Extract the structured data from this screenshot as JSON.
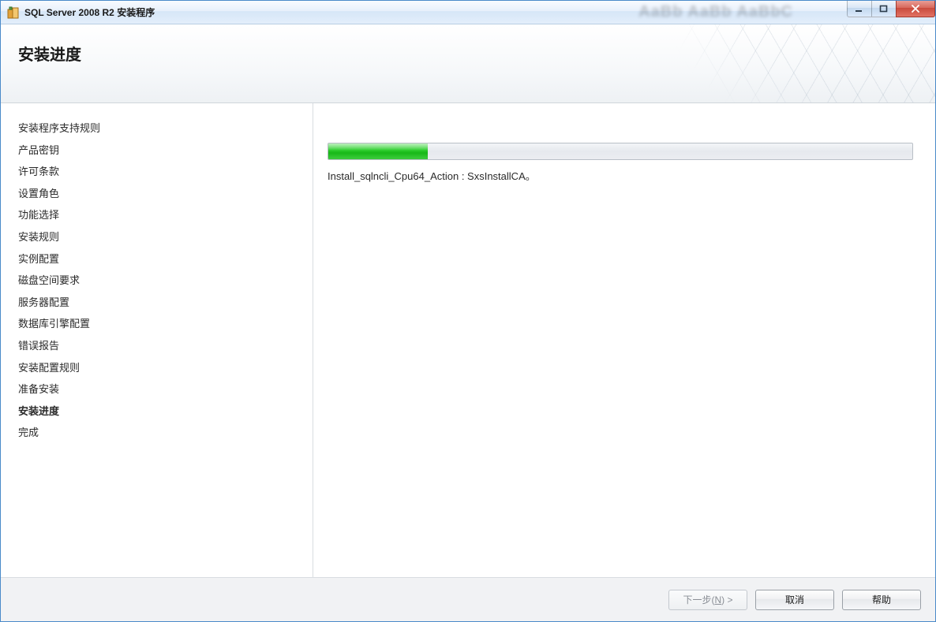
{
  "window": {
    "title": "SQL Server 2008 R2 安装程序"
  },
  "titlebar_bg_blur": "AaBb AaBb AaBbC",
  "header": {
    "page_title": "安装进度"
  },
  "sidebar": {
    "steps": [
      {
        "label": "安装程序支持规则",
        "current": false
      },
      {
        "label": "产品密钥",
        "current": false
      },
      {
        "label": "许可条款",
        "current": false
      },
      {
        "label": "设置角色",
        "current": false
      },
      {
        "label": "功能选择",
        "current": false
      },
      {
        "label": "安装规则",
        "current": false
      },
      {
        "label": "实例配置",
        "current": false
      },
      {
        "label": "磁盘空间要求",
        "current": false
      },
      {
        "label": "服务器配置",
        "current": false
      },
      {
        "label": "数据库引擎配置",
        "current": false
      },
      {
        "label": "错误报告",
        "current": false
      },
      {
        "label": "安装配置规则",
        "current": false
      },
      {
        "label": "准备安装",
        "current": false
      },
      {
        "label": "安装进度",
        "current": true
      },
      {
        "label": "完成",
        "current": false
      }
    ]
  },
  "progress": {
    "percent": 17,
    "status_text": "Install_sqlncli_Cpu64_Action : SxsInstallCA。"
  },
  "footer": {
    "next_prefix": "下一步(",
    "next_key": "N",
    "next_suffix": ") >",
    "cancel_label": "取消",
    "help_label": "帮助"
  },
  "colors": {
    "progress_green": "#2fcf2f",
    "window_border": "#4a8ac9"
  }
}
